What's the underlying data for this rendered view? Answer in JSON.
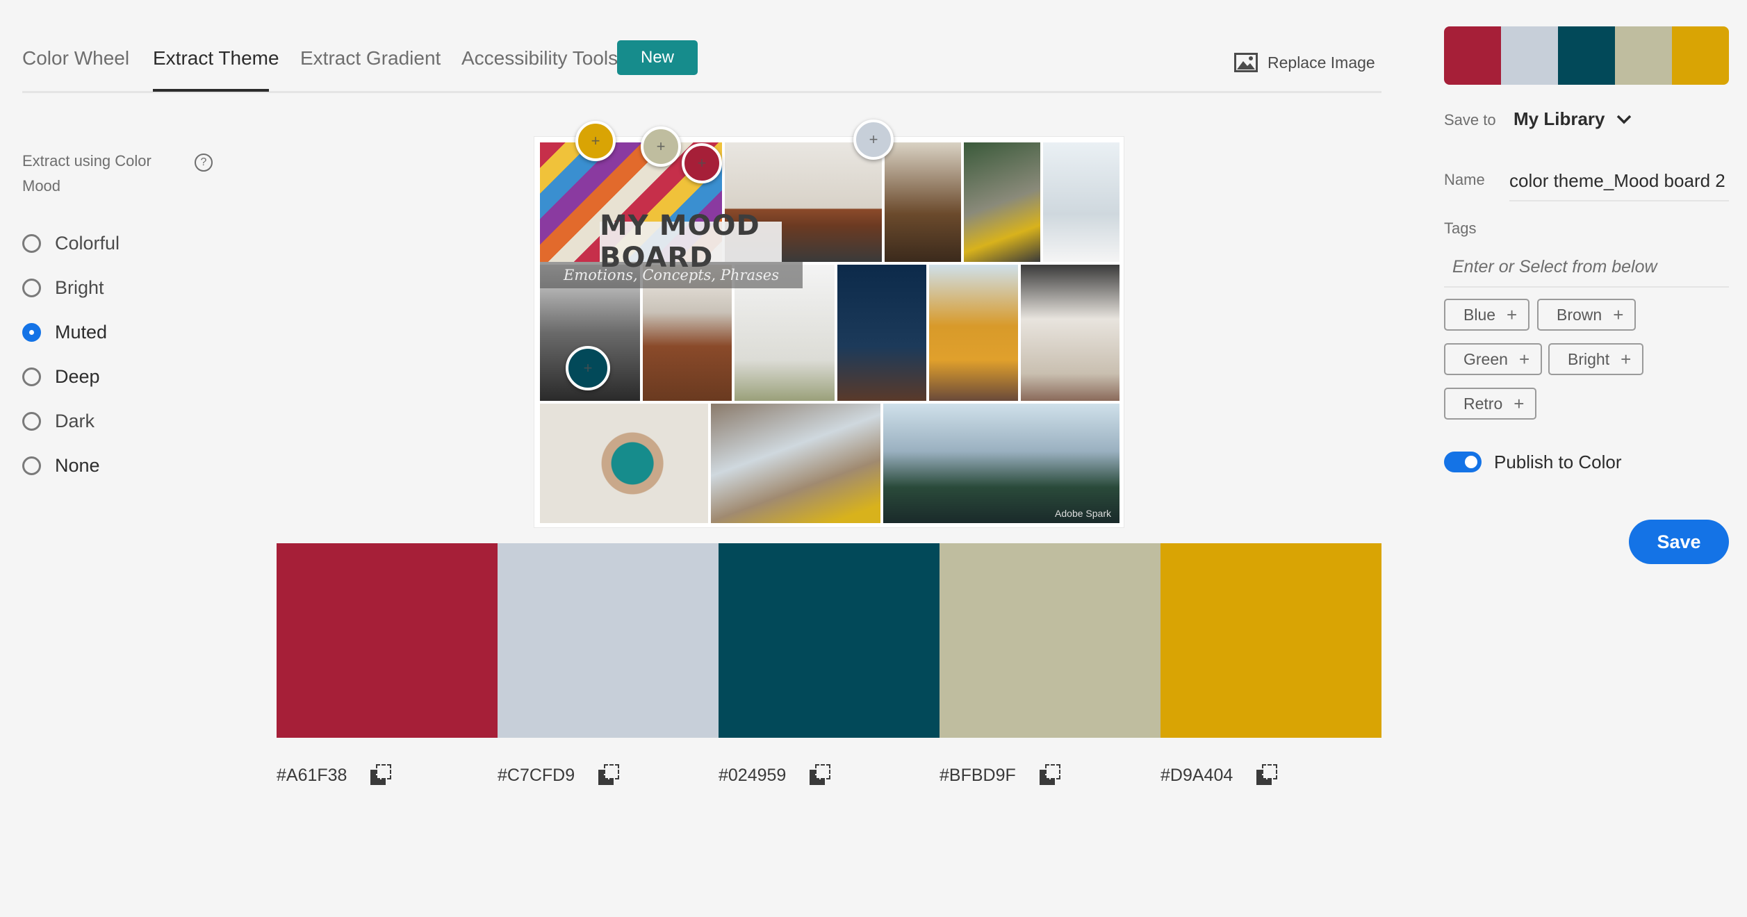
{
  "tabs": [
    {
      "label": "Color Wheel",
      "active": false
    },
    {
      "label": "Extract Theme",
      "active": true
    },
    {
      "label": "Extract Gradient",
      "active": false
    },
    {
      "label": "Accessibility Tools",
      "active": false
    }
  ],
  "badge_new": "New",
  "replace_image": "Replace Image",
  "mood_panel": {
    "label": "Extract using Color Mood",
    "help": "?",
    "options": [
      {
        "label": "Colorful",
        "checked": false
      },
      {
        "label": "Bright",
        "checked": false
      },
      {
        "label": "Muted",
        "checked": true
      },
      {
        "label": "Deep",
        "checked": false
      },
      {
        "label": "Dark",
        "checked": false
      },
      {
        "label": "None",
        "checked": false
      }
    ]
  },
  "board": {
    "title": "MY MOOD BOARD",
    "subtitle": "Emotions, Concepts, Phrases",
    "watermark": "Adobe Spark"
  },
  "picker_glyph": "+",
  "swatches": [
    {
      "hex": "#A61F38",
      "color": "#A61F38"
    },
    {
      "hex": "#C7CFD9",
      "color": "#C7CFD9"
    },
    {
      "hex": "#024959",
      "color": "#024959"
    },
    {
      "hex": "#BFBD9F",
      "color": "#BFBD9F"
    },
    {
      "hex": "#D9A404",
      "color": "#D9A404"
    }
  ],
  "right_panel": {
    "save_to_label": "Save to",
    "library": "My Library",
    "name_label": "Name",
    "name_value": "color theme_Mood board 2",
    "tags_label": "Tags",
    "tags_placeholder": "Enter or Select from below",
    "tags": [
      "Blue",
      "Brown",
      "Green",
      "Bright",
      "Retro"
    ],
    "tag_plus": "+",
    "publish_label": "Publish to Color",
    "publish_on": true,
    "save_label": "Save"
  }
}
